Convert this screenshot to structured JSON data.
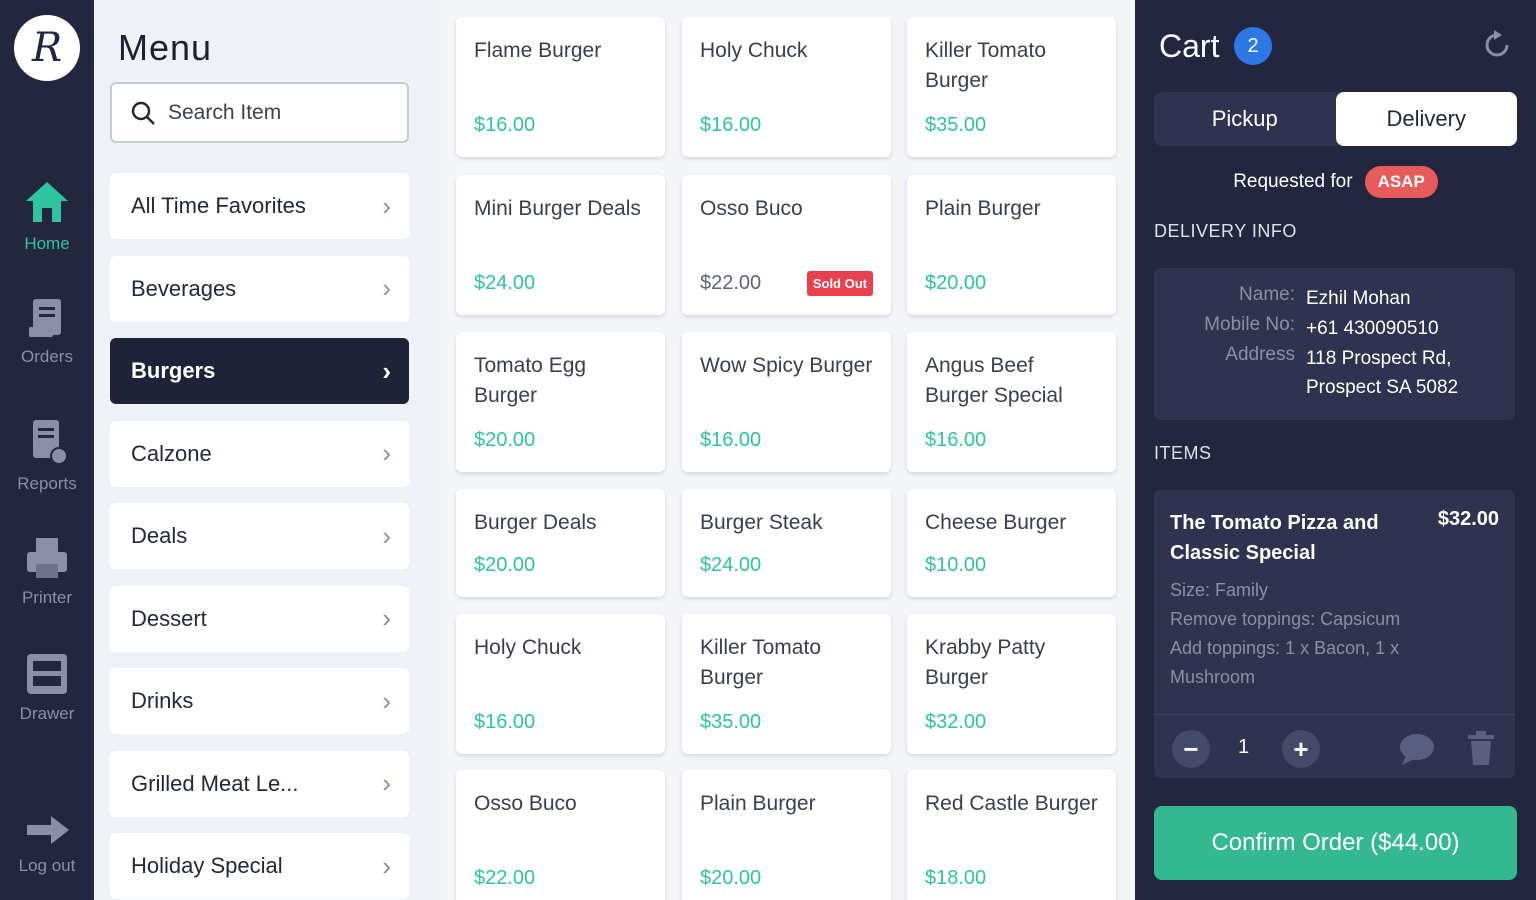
{
  "brand": {
    "logo_letter": "R"
  },
  "nav": [
    {
      "label": "Home",
      "icon": "home-icon",
      "active": true
    },
    {
      "label": "Orders",
      "icon": "receipt-icon"
    },
    {
      "label": "Reports",
      "icon": "report-icon"
    },
    {
      "label": "Printer",
      "icon": "printer-icon"
    },
    {
      "label": "Drawer",
      "icon": "drawer-icon"
    },
    {
      "label": "Log out",
      "icon": "logout-icon"
    }
  ],
  "menu": {
    "title": "Menu",
    "search_placeholder": "Search Item",
    "categories": [
      "All Time Favorites",
      "Beverages",
      "Burgers",
      "Calzone",
      "Deals",
      "Dessert",
      "Drinks",
      "Grilled Meat Le...",
      "Holiday Special"
    ],
    "active_category": "Burgers"
  },
  "products": [
    {
      "name": "Flame Burger",
      "price": "$16.00"
    },
    {
      "name": "Holy Chuck",
      "price": "$16.00"
    },
    {
      "name": "Killer Tomato Burger",
      "price": "$35.00"
    },
    {
      "name": "Mini Burger Deals",
      "price": "$24.00"
    },
    {
      "name": "Osso Buco",
      "price": "$22.00",
      "badge": "Sold Out"
    },
    {
      "name": "Plain Burger",
      "price": "$20.00"
    },
    {
      "name": "Tomato Egg Burger",
      "price": "$20.00"
    },
    {
      "name": "Wow Spicy Burger",
      "price": "$16.00"
    },
    {
      "name": "Angus Beef Burger Special",
      "price": "$16.00"
    },
    {
      "name": "Burger Deals",
      "price": "$20.00"
    },
    {
      "name": "Burger Steak",
      "price": "$24.00"
    },
    {
      "name": "Cheese Burger",
      "price": "$10.00"
    },
    {
      "name": "Holy Chuck",
      "price": "$16.00"
    },
    {
      "name": "Killer Tomato Burger",
      "price": "$35.00"
    },
    {
      "name": "Krabby Patty Burger",
      "price": "$32.00"
    },
    {
      "name": "Osso Buco",
      "price": "$22.00"
    },
    {
      "name": "Plain Burger",
      "price": "$20.00"
    },
    {
      "name": "Red Castle Burger",
      "price": "$18.00"
    }
  ],
  "cart": {
    "title": "Cart",
    "count": "2",
    "modes": [
      "Pickup",
      "Delivery"
    ],
    "selected_mode": "Delivery",
    "requested_label": "Requested for",
    "requested_value": "ASAP",
    "delivery_heading": "DELIVERY INFO",
    "delivery": {
      "name_label": "Name:",
      "name": "Ezhil Mohan",
      "mobile_label": "Mobile No:",
      "mobile": "+61 430090510",
      "address_label": "Address",
      "address_line1": "118 Prospect Rd,",
      "address_line2": "Prospect SA 5082"
    },
    "items_heading": "ITEMS",
    "item": {
      "name": "The Tomato Pizza and Classic Special",
      "price": "$32.00",
      "size": "Size: Family",
      "remove": "Remove toppings: Capsicum",
      "add": "Add toppings: 1 x Bacon, 1 x Mushroom",
      "qty": "1"
    },
    "confirm_label": "Confirm Order ($44.00)"
  },
  "colors": {
    "accent": "#2ec4a0",
    "dark": "#23263f",
    "badge_blue": "#2e78e6",
    "alert": "#e8404f"
  }
}
